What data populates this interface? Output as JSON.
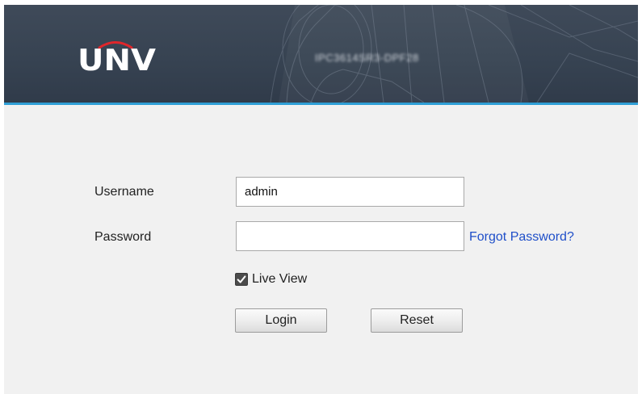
{
  "header": {
    "logo_text": "UNV",
    "model_text": "IPC3614SR3-DPF28",
    "colors": {
      "background": "#374352",
      "accent_line": "#2f9fd6",
      "logo_arc": "#e0262b"
    },
    "background_art": "camera-outline-illustration"
  },
  "form": {
    "username_label": "Username",
    "username_value": "admin",
    "password_label": "Password",
    "password_value": "",
    "forgot_password_label": "Forgot Password?",
    "live_view_label": "Live View",
    "live_view_checked": true,
    "login_label": "Login",
    "reset_label": "Reset",
    "link_color": "#1f4fc9"
  },
  "icons": {
    "checkbox": "checkmark-icon",
    "logo_arc": "logo-arc-icon"
  }
}
